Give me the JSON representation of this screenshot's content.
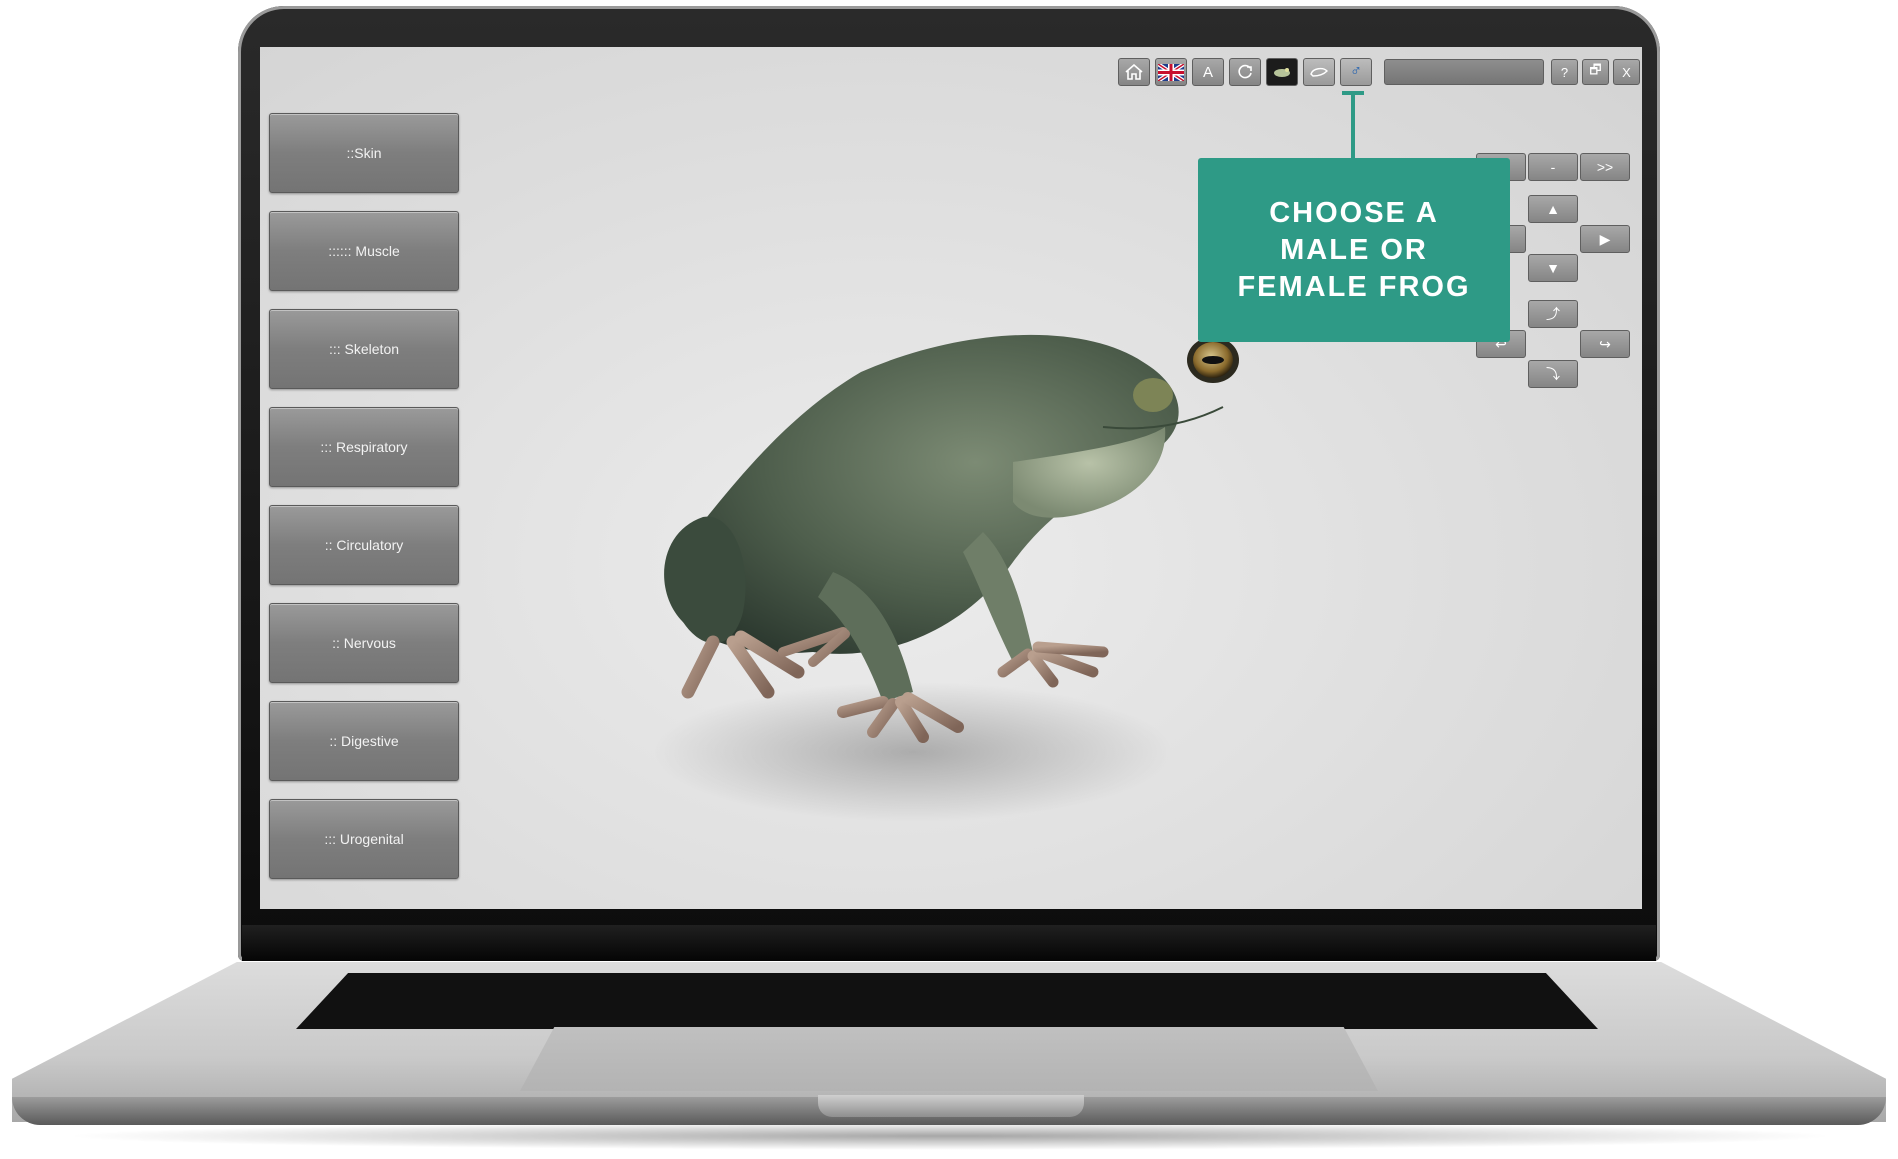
{
  "sidebar": {
    "items": [
      {
        "label": "::Skin"
      },
      {
        "label": ":::::: Muscle"
      },
      {
        "label": "::: Skeleton"
      },
      {
        "label": "::: Respiratory"
      },
      {
        "label": ":: Circulatory"
      },
      {
        "label": ":: Nervous"
      },
      {
        "label": ":: Digestive"
      },
      {
        "label": "::: Urogenital"
      }
    ]
  },
  "toolbar": {
    "home_icon": "home-icon",
    "language_icon": "uk-flag-icon",
    "labels_btn": "A",
    "reset_icon": "refresh-icon",
    "gender_symbol": "♂"
  },
  "window_controls": {
    "help": "?",
    "restore": "🗗",
    "close": "X"
  },
  "navigation": {
    "prev": "<<",
    "middle": "-",
    "next": ">>"
  },
  "callout": {
    "text": "CHOOSE A MALE OR FEMALE FROG",
    "color": "#2e9a86"
  }
}
